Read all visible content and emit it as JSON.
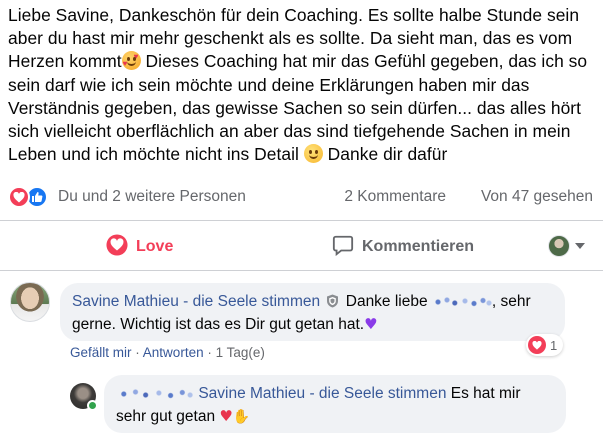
{
  "post": {
    "text_part1": "Liebe Savine, Dankeschön für dein Coaching. Es sollte halbe Stunde sein aber du hast mir mehr geschenkt als es sollte. Da sieht man, das es vom Herzen kommt",
    "text_part2": " Dieses Coaching hat mir das Gefühl gegeben, das ich so sein darf wie ich sein möchte und deine Erklärungen haben mir das Verständnis gegeben, das gewisse Sachen so sein dürfen... das alles hört sich vielleicht oberflächlich an aber das sind tiefgehende Sachen in mein Leben und ich möchte nicht ins Detail",
    "text_part3": " Danke dir dafür"
  },
  "stats": {
    "people": "Du und 2 weitere Personen",
    "comments": "2 Kommentare",
    "views": "Von 47 gesehen"
  },
  "actions": {
    "love_label": "Love",
    "comment_label": "Kommentieren"
  },
  "comments": [
    {
      "author": "Savine Mathieu - die Seele stimmen",
      "text_a": "Danke liebe",
      "text_b": ", sehr gerne. Wichtig ist das es Dir gut getan hat.",
      "reaction_count": "1",
      "like_label": "Gefällt mir",
      "reply_label": "Antworten",
      "time": "1 Tag(e)"
    },
    {
      "mention": "Savine Mathieu - die Seele stimmen",
      "text": "Es hat mir sehr gut getan"
    }
  ],
  "icons": {
    "love": "heart-icon",
    "like": "thumbs-up-icon",
    "comment": "speech-bubble-icon",
    "verified": "shield-icon"
  },
  "colors": {
    "love": "#f33e58",
    "like": "#1877f2",
    "link": "#385898",
    "muted": "#65676b",
    "bubble": "#f0f2f5"
  }
}
